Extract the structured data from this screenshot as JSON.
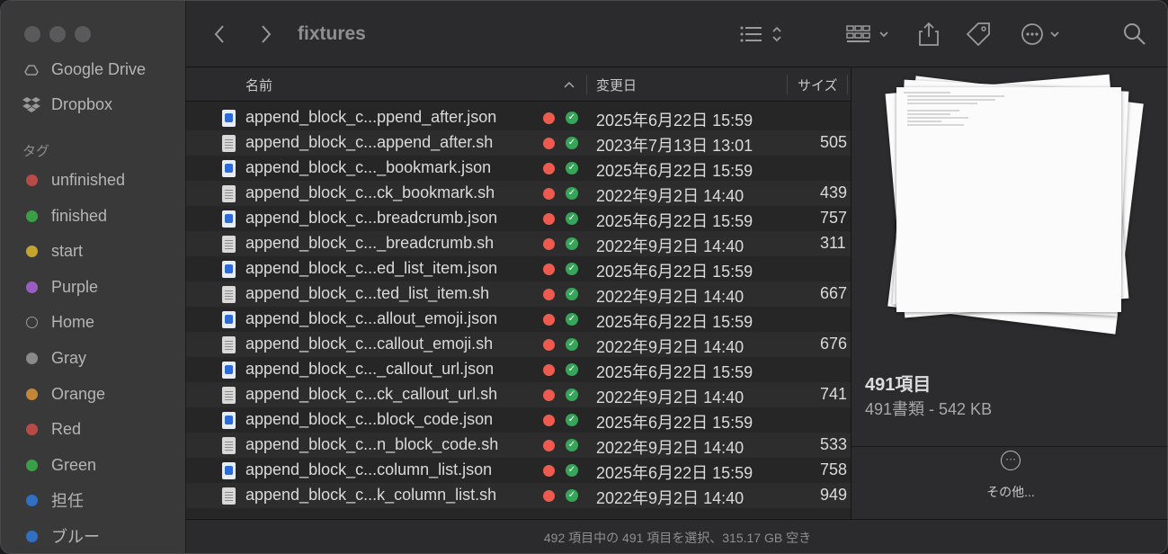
{
  "window": {
    "title": "fixtures"
  },
  "sidebar": {
    "locations": [
      {
        "label": "Google Drive",
        "icon": "google-drive-icon"
      },
      {
        "label": "Dropbox",
        "icon": "dropbox-icon"
      }
    ],
    "tags_heading": "タグ",
    "tags": [
      {
        "label": "unfinished",
        "color": "#b84b45"
      },
      {
        "label": "finished",
        "color": "#3aa046"
      },
      {
        "label": "start",
        "color": "#c4a330"
      },
      {
        "label": "Purple",
        "color": "#9b5cc4"
      },
      {
        "label": "Home",
        "color": ""
      },
      {
        "label": "Gray",
        "color": "#8a8a8a"
      },
      {
        "label": "Orange",
        "color": "#c4873a"
      },
      {
        "label": "Red",
        "color": "#b84b45"
      },
      {
        "label": "Green",
        "color": "#3aa046"
      },
      {
        "label": "担任",
        "color": "#2f6fc4"
      },
      {
        "label": "ブルー",
        "color": "#2f6fc4"
      }
    ]
  },
  "columns": {
    "name": "名前",
    "modified": "変更日",
    "size": "サイズ"
  },
  "files": [
    {
      "name": "append_block_c...ppend_after.json",
      "type": "json",
      "date": "2025年6月22日 15:59",
      "size": ""
    },
    {
      "name": "append_block_c...append_after.sh",
      "type": "sh",
      "date": "2023年7月13日 13:01",
      "size": "505"
    },
    {
      "name": "append_block_c..._bookmark.json",
      "type": "json",
      "date": "2025年6月22日 15:59",
      "size": ""
    },
    {
      "name": "append_block_c...ck_bookmark.sh",
      "type": "sh",
      "date": "2022年9月2日 14:40",
      "size": "439"
    },
    {
      "name": "append_block_c...breadcrumb.json",
      "type": "json",
      "date": "2025年6月22日 15:59",
      "size": "757"
    },
    {
      "name": "append_block_c..._breadcrumb.sh",
      "type": "sh",
      "date": "2022年9月2日 14:40",
      "size": "311"
    },
    {
      "name": "append_block_c...ed_list_item.json",
      "type": "json",
      "date": "2025年6月22日 15:59",
      "size": ""
    },
    {
      "name": "append_block_c...ted_list_item.sh",
      "type": "sh",
      "date": "2022年9月2日 14:40",
      "size": "667"
    },
    {
      "name": "append_block_c...allout_emoji.json",
      "type": "json",
      "date": "2025年6月22日 15:59",
      "size": ""
    },
    {
      "name": "append_block_c...callout_emoji.sh",
      "type": "sh",
      "date": "2022年9月2日 14:40",
      "size": "676"
    },
    {
      "name": "append_block_c..._callout_url.json",
      "type": "json",
      "date": "2025年6月22日 15:59",
      "size": ""
    },
    {
      "name": "append_block_c...ck_callout_url.sh",
      "type": "sh",
      "date": "2022年9月2日 14:40",
      "size": "741"
    },
    {
      "name": "append_block_c...block_code.json",
      "type": "json",
      "date": "2025年6月22日 15:59",
      "size": ""
    },
    {
      "name": "append_block_c...n_block_code.sh",
      "type": "sh",
      "date": "2022年9月2日 14:40",
      "size": "533"
    },
    {
      "name": "append_block_c...column_list.json",
      "type": "json",
      "date": "2025年6月22日 15:59",
      "size": "758"
    },
    {
      "name": "append_block_c...k_column_list.sh",
      "type": "sh",
      "date": "2022年9月2日 14:40",
      "size": "949"
    }
  ],
  "preview": {
    "count": "491項目",
    "summary": "491書類 - 542 KB",
    "more_label": "その他..."
  },
  "status": "492 項目中の 491 項目を選択、315.17 GB 空き"
}
